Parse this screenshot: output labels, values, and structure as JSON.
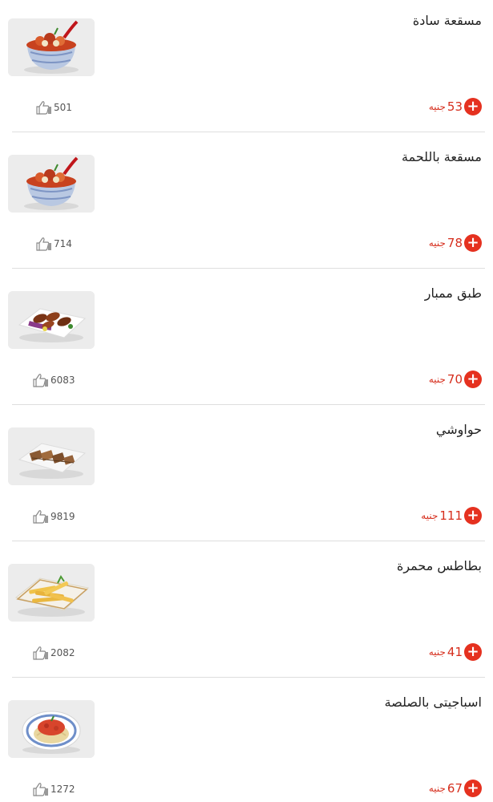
{
  "items": [
    {
      "name": "مسقعة سادة",
      "price": "53",
      "currency": "جنيه",
      "likes": "501",
      "image": "eggplant-bowl"
    },
    {
      "name": "مسقعة باللحمة",
      "price": "78",
      "currency": "جنيه",
      "likes": "714",
      "image": "eggplant-bowl"
    },
    {
      "name": "طبق ممبار",
      "price": "70",
      "currency": "جنيه",
      "likes": "6083",
      "image": "mumbar-plate"
    },
    {
      "name": "حواوشي",
      "price": "111",
      "currency": "جنيه",
      "likes": "9819",
      "image": "hawawshi-plate"
    },
    {
      "name": "بطاطس محمرة",
      "price": "41",
      "currency": "جنيه",
      "likes": "2082",
      "image": "fries-plate"
    },
    {
      "name": "اسباجيتى بالصلصة",
      "price": "67",
      "currency": "جنيه",
      "likes": "1272",
      "image": "spaghetti-plate"
    }
  ],
  "colors": {
    "accent": "#e5311f",
    "price_text": "#d62e1d",
    "divider": "#dedede"
  },
  "icons": {
    "add": "plus-circle-icon",
    "like": "thumbs-up-icon"
  }
}
